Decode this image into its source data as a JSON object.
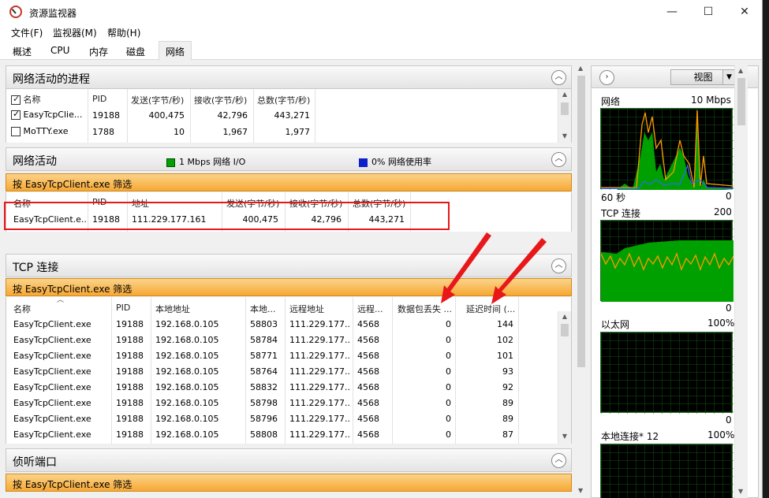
{
  "window": {
    "title": "资源监视器",
    "minimize": "—",
    "maximize": "☐",
    "close": "✕"
  },
  "menu": [
    "文件(F)",
    "监视器(M)",
    "帮助(H)"
  ],
  "tabs": [
    "概述",
    "CPU",
    "内存",
    "磁盘",
    "网络"
  ],
  "active_tab": "网络",
  "processes": {
    "title": "网络活动的进程",
    "columns": [
      "名称",
      "PID",
      "发送(字节/秒)",
      "接收(字节/秒)",
      "总数(字节/秒)"
    ],
    "rows": [
      {
        "checked": true,
        "name": "EasyTcpClie...",
        "pid": "19188",
        "send": "400,475",
        "recv": "42,796",
        "total": "443,271"
      },
      {
        "checked": false,
        "name": "MoTTY.exe",
        "pid": "1788",
        "send": "10",
        "recv": "1,967",
        "total": "1,977"
      }
    ]
  },
  "network_activity": {
    "title": "网络活动",
    "legend_io": "1 Mbps 网络 I/O",
    "legend_usage": "0% 网络使用率",
    "filter": "按 EasyTcpClient.exe 筛选",
    "columns": [
      "名称",
      "PID",
      "地址",
      "发送(字节/秒)",
      "接收(字节/秒)",
      "总数(字节/秒)"
    ],
    "rows": [
      {
        "name": "EasyTcpClient.e...",
        "pid": "19188",
        "addr": "111.229.177.161",
        "send": "400,475",
        "recv": "42,796",
        "total": "443,271"
      }
    ]
  },
  "tcp": {
    "title": "TCP 连接",
    "filter": "按 EasyTcpClient.exe 筛选",
    "columns": [
      "名称",
      "PID",
      "本地地址",
      "本地...",
      "远程地址",
      "远程...",
      "数据包丢失 ...",
      "延迟时间 (..."
    ],
    "rows": [
      {
        "name": "EasyTcpClient.exe",
        "pid": "19188",
        "laddr": "192.168.0.105",
        "lport": "58803",
        "raddr": "111.229.177....",
        "rport": "4568",
        "loss": "0",
        "lat": "144"
      },
      {
        "name": "EasyTcpClient.exe",
        "pid": "19188",
        "laddr": "192.168.0.105",
        "lport": "58784",
        "raddr": "111.229.177....",
        "rport": "4568",
        "loss": "0",
        "lat": "102"
      },
      {
        "name": "EasyTcpClient.exe",
        "pid": "19188",
        "laddr": "192.168.0.105",
        "lport": "58771",
        "raddr": "111.229.177....",
        "rport": "4568",
        "loss": "0",
        "lat": "101"
      },
      {
        "name": "EasyTcpClient.exe",
        "pid": "19188",
        "laddr": "192.168.0.105",
        "lport": "58764",
        "raddr": "111.229.177....",
        "rport": "4568",
        "loss": "0",
        "lat": "93"
      },
      {
        "name": "EasyTcpClient.exe",
        "pid": "19188",
        "laddr": "192.168.0.105",
        "lport": "58832",
        "raddr": "111.229.177....",
        "rport": "4568",
        "loss": "0",
        "lat": "92"
      },
      {
        "name": "EasyTcpClient.exe",
        "pid": "19188",
        "laddr": "192.168.0.105",
        "lport": "58798",
        "raddr": "111.229.177....",
        "rport": "4568",
        "loss": "0",
        "lat": "89"
      },
      {
        "name": "EasyTcpClient.exe",
        "pid": "19188",
        "laddr": "192.168.0.105",
        "lport": "58796",
        "raddr": "111.229.177....",
        "rport": "4568",
        "loss": "0",
        "lat": "89"
      },
      {
        "name": "EasyTcpClient.exe",
        "pid": "19188",
        "laddr": "192.168.0.105",
        "lport": "58808",
        "raddr": "111.229.177....",
        "rport": "4568",
        "loss": "0",
        "lat": "87"
      }
    ]
  },
  "listening": {
    "title": "侦听端口",
    "filter": "按 EasyTcpClient.exe 筛选"
  },
  "right_panel": {
    "view_button": "视图",
    "graphs": [
      {
        "label": "网络",
        "max": "10 Mbps",
        "time": "60 秒",
        "min": "0"
      },
      {
        "label": "TCP 连接",
        "max": "200",
        "min": "0"
      },
      {
        "label": "以太网",
        "max": "100%",
        "min": "0"
      },
      {
        "label": "本地连接* 12",
        "max": "100%"
      }
    ]
  },
  "colors": {
    "filter_orange": "#f7a834",
    "graph_green": "#00c000",
    "graph_orange": "#ff9900",
    "graph_blue": "#3366ff",
    "annotation_red": "#e8171a"
  }
}
